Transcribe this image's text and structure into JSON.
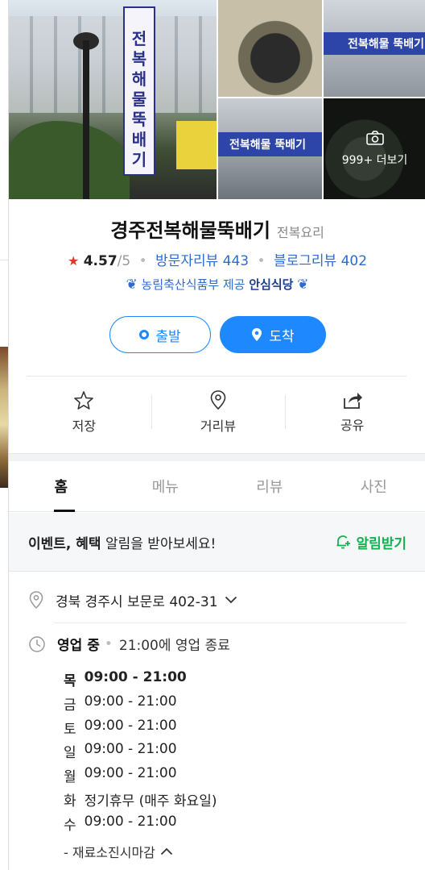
{
  "photos": {
    "sign_text": "전복해물뚝배기",
    "banner_text": "전복해물 뚝배기",
    "more_label": "999+ 더보기"
  },
  "place": {
    "name": "경주전복해물뚝배기",
    "category": "전복요리",
    "rating": "4.57",
    "rating_max": "/5",
    "visitor_reviews": "방문자리뷰 443",
    "blog_reviews": "블로그리뷰 402",
    "cert_text": "농림축산식품부 제공",
    "cert_badge": "안심식당"
  },
  "route": {
    "start_label": "출발",
    "arrive_label": "도착"
  },
  "actions": {
    "save_label": "저장",
    "street_label": "거리뷰",
    "share_label": "공유"
  },
  "tabs": [
    "홈",
    "메뉴",
    "리뷰",
    "사진"
  ],
  "notice": {
    "bold_text": "이벤트, 혜택",
    "text": " 알림을 받아보세요!",
    "button": "알림받기"
  },
  "address": "경북 경주시 보문로 402-31",
  "hours": {
    "status": "영업 중",
    "note": "21:00에 영업 종료",
    "days": [
      {
        "day": "목",
        "time": "09:00 - 21:00"
      },
      {
        "day": "금",
        "time": "09:00 - 21:00"
      },
      {
        "day": "토",
        "time": "09:00 - 21:00"
      },
      {
        "day": "일",
        "time": "09:00 - 21:00"
      },
      {
        "day": "월",
        "time": "09:00 - 21:00"
      },
      {
        "day": "화",
        "time": "정기휴무 (매주 화요일)"
      },
      {
        "day": "수",
        "time": "09:00 - 21:00"
      }
    ],
    "extra": "- 재료소진시마감"
  },
  "colors": {
    "accent": "#1e88ff",
    "link": "#2e6bd0",
    "star": "#e0372b",
    "notify": "#12b24f"
  }
}
